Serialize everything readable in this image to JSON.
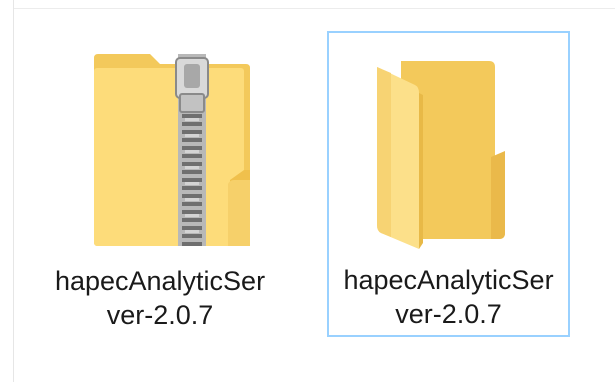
{
  "files": [
    {
      "name": "hapecAnalyticSer\nver-2.0.7",
      "type": "zip-folder-icon",
      "selected": false
    },
    {
      "name": "hapecAnalyticSer\nver-2.0.7",
      "type": "folder-icon",
      "selected": true
    }
  ],
  "colors": {
    "folder_light": "#fde68a",
    "folder_mid": "#f8d775",
    "folder_dark": "#e9b949",
    "zipper": "#9a9a9a",
    "selection_border": "#99d1ff"
  }
}
